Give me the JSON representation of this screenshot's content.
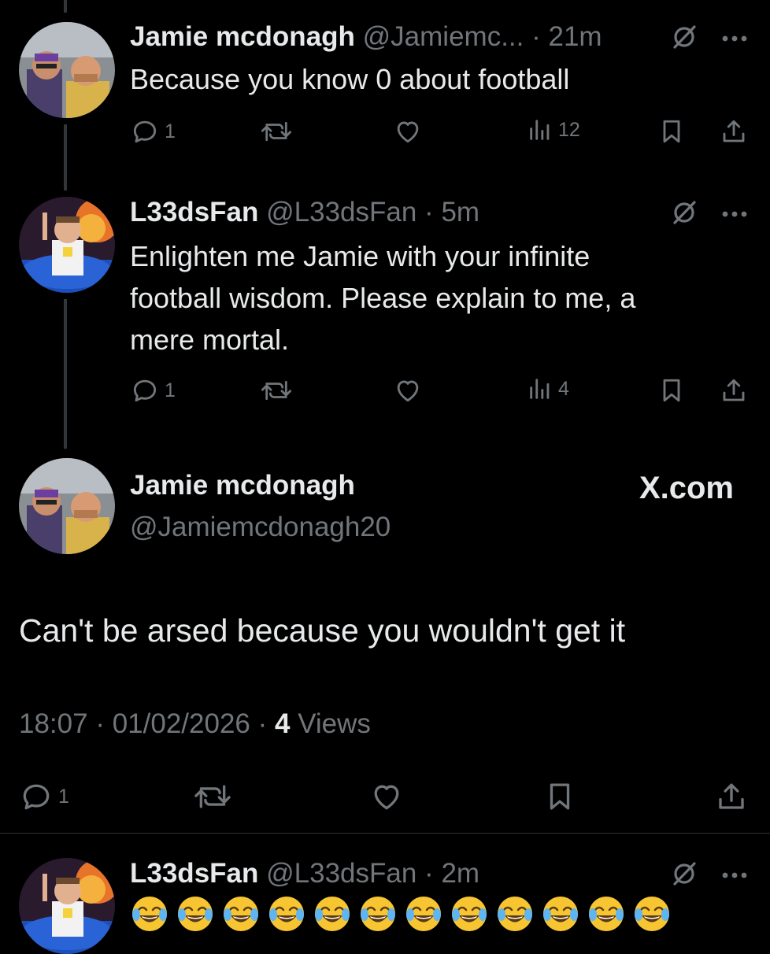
{
  "colors": {
    "background": "#000000",
    "text": "#e7e9ea",
    "muted": "#71767b",
    "divider": "#2f3336"
  },
  "replies": [
    {
      "name": "Jamie mcdonagh",
      "handle": "@Jamiemc...",
      "time": "21m",
      "text": "Because you know 0 about football",
      "replies": "1",
      "views": "12"
    },
    {
      "name": "L33dsFan",
      "handle": "@L33dsFan",
      "time": "5m",
      "text_lines": [
        "Enlighten me Jamie with your infinite",
        "football wisdom. Please explain to me, a",
        "mere mortal."
      ],
      "replies": "1",
      "views": "4"
    }
  ],
  "main_post": {
    "name": "Jamie mcdonagh",
    "handle": "@Jamiemcdonagh20",
    "site": "X.com",
    "text": "Can't be arsed because you wouldn't get it",
    "time": "18:07",
    "date": "01/02/2026",
    "views_count": "4",
    "views_label": "Views",
    "replies": "1"
  },
  "bottom_reply": {
    "name": "L33dsFan",
    "handle": "@L33dsFan",
    "time": "2m",
    "emoji_count": 12
  },
  "icons": [
    "reply-icon",
    "retweet-icon",
    "like-icon",
    "views-icon",
    "bookmark-icon",
    "share-icon",
    "grok-icon",
    "more-icon"
  ]
}
